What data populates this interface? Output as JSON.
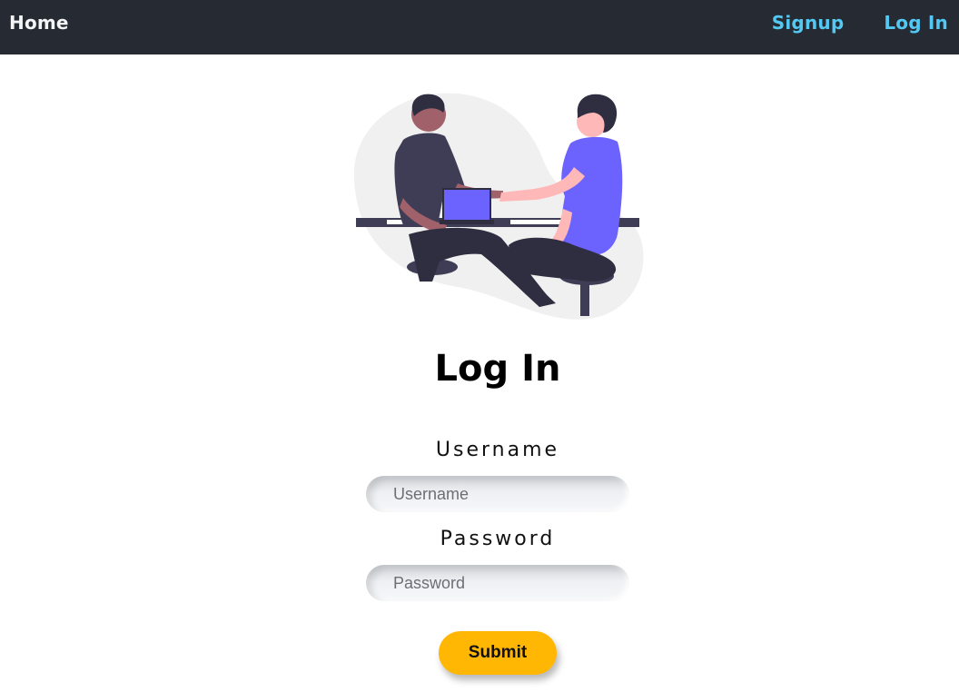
{
  "navbar": {
    "home_label": "Home",
    "links": [
      {
        "label": "Signup"
      },
      {
        "label": "Log In"
      }
    ],
    "colors": {
      "background": "#252a33",
      "link": "#52c8f2",
      "home": "#f3f4f6"
    }
  },
  "hero": {
    "illustration": "two-people-handshake-illustration"
  },
  "form": {
    "title": "Log In",
    "username": {
      "label": "Username",
      "placeholder": "Username",
      "value": ""
    },
    "password": {
      "label": "Password",
      "placeholder": "Password",
      "value": ""
    },
    "submit_label": "Submit",
    "submit_color": "#ffb703"
  }
}
